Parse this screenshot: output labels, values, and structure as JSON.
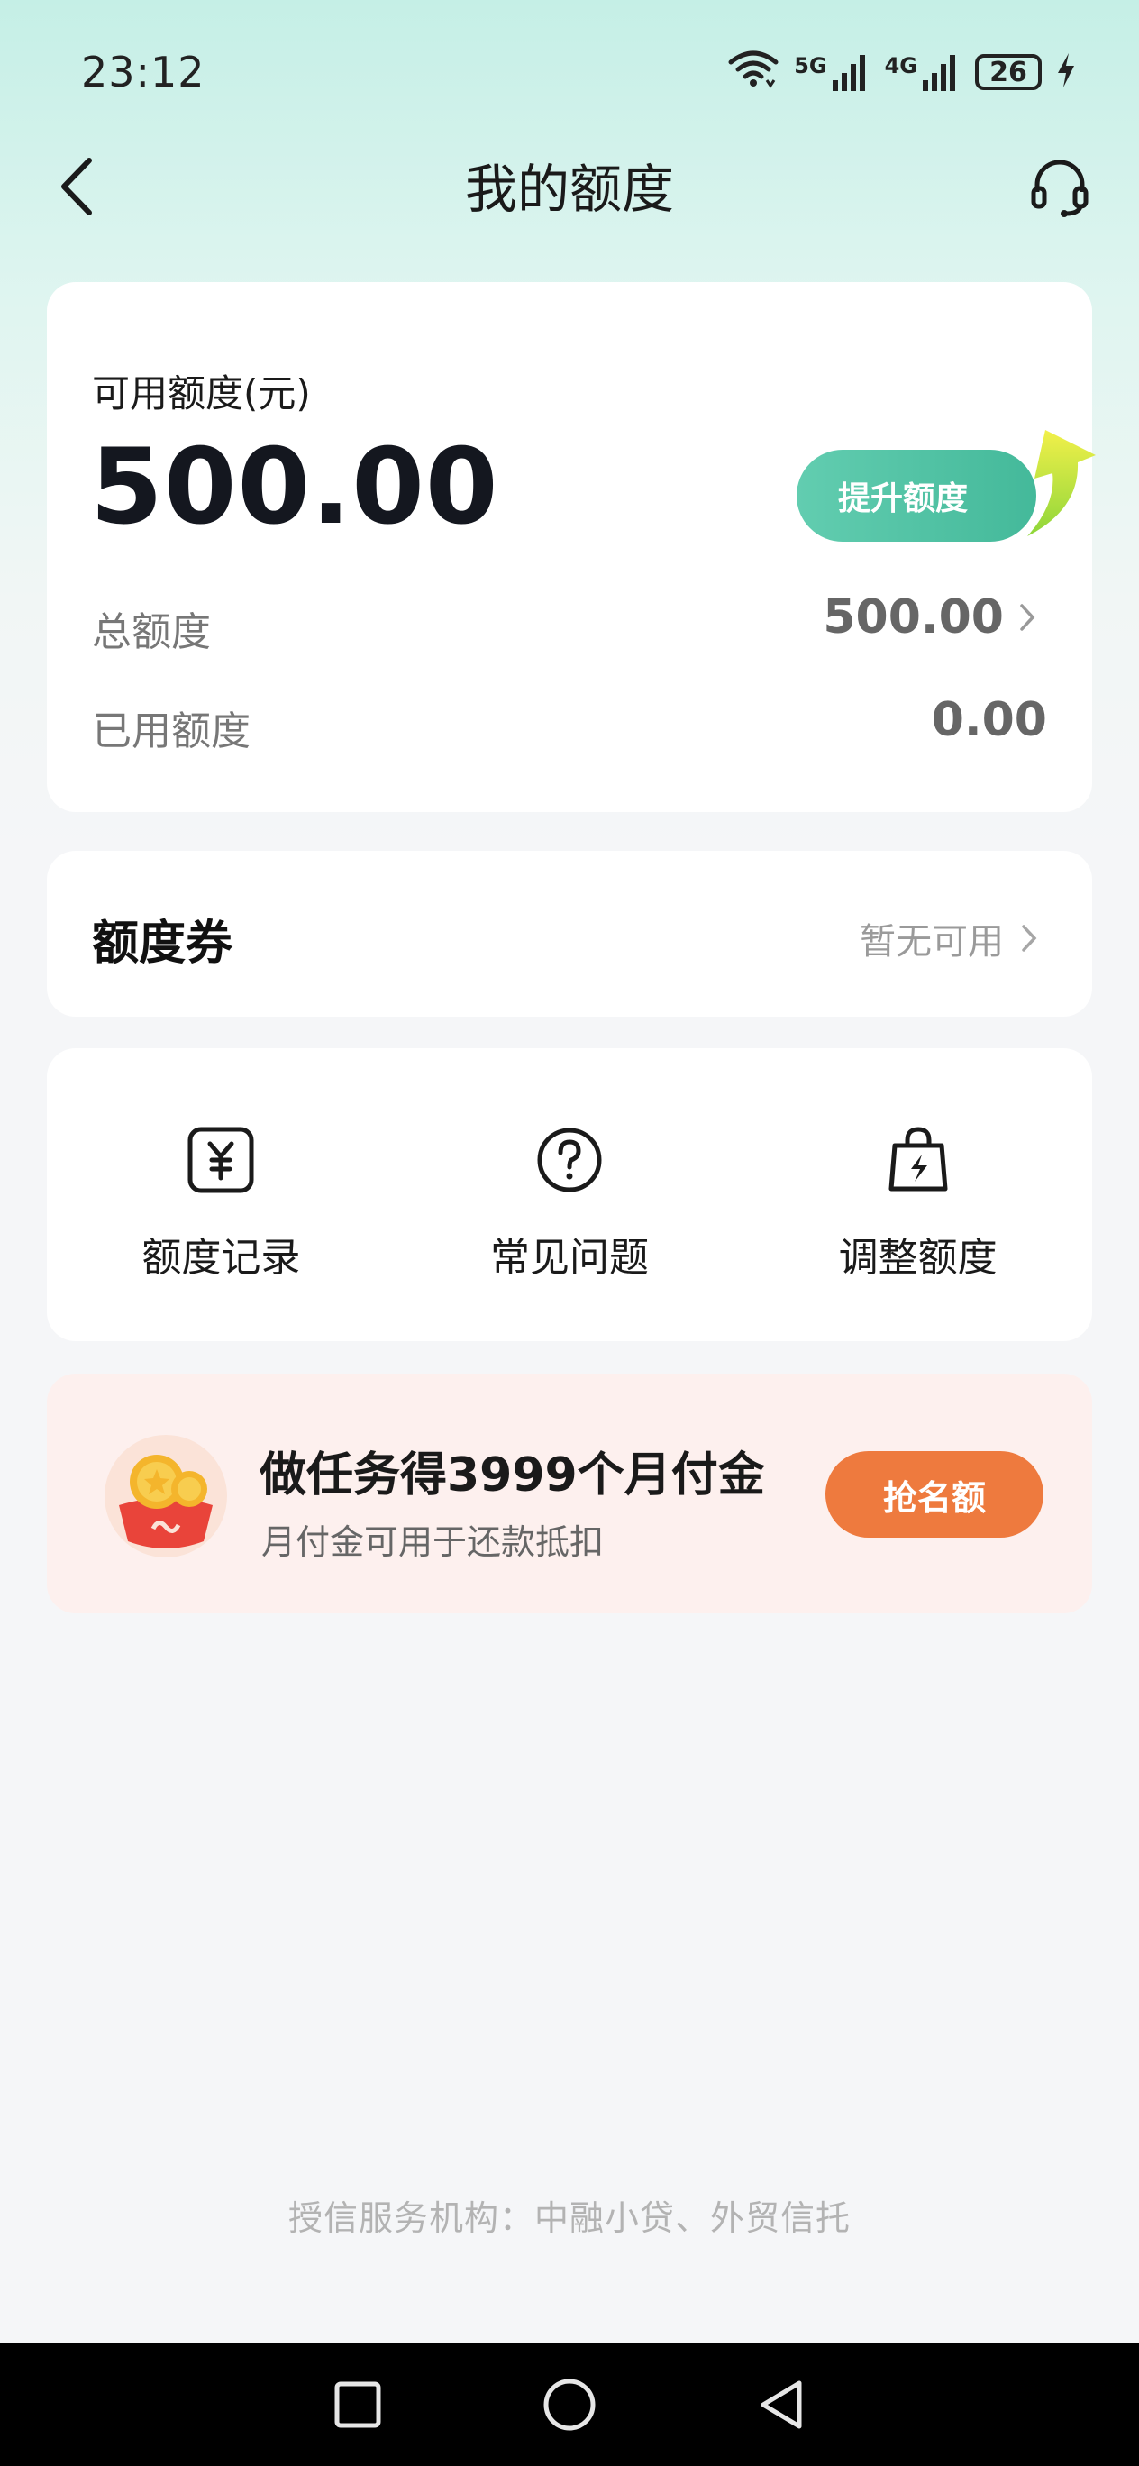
{
  "status_bar": {
    "time": "23:12",
    "network1": "5G",
    "network2": "4G",
    "battery": "26"
  },
  "nav": {
    "title": "我的额度",
    "back_icon": "chevron-left-icon",
    "service_icon": "headset-icon"
  },
  "credit": {
    "label": "可用额度(元)",
    "amount": "500.00",
    "boost_label": "提升额度",
    "total_label": "总额度",
    "total_value": "500.00",
    "used_label": "已用额度",
    "used_value": "0.00"
  },
  "coupon": {
    "title": "额度券",
    "status": "暂无可用"
  },
  "shortcuts": [
    {
      "label": "额度记录",
      "icon": "yuan-receipt-icon"
    },
    {
      "label": "常见问题",
      "icon": "question-circle-icon"
    },
    {
      "label": "调整额度",
      "icon": "bolt-bag-icon"
    }
  ],
  "promo": {
    "title": "做任务得3999个月付金",
    "subtitle": "月付金可用于还款抵扣",
    "button": "抢名额",
    "icon": "coin-pouch-icon"
  },
  "footer": {
    "text": "授信服务机构：中融小贷、外贸信托"
  },
  "colors": {
    "accent_green": "#4fc3a4",
    "promo_orange": "#ee7a3e",
    "promo_bg": "#fdf0ee"
  }
}
